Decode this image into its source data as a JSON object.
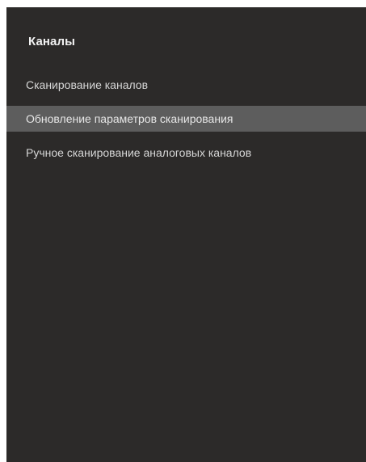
{
  "panel": {
    "title": "Каналы"
  },
  "menu": {
    "items": [
      {
        "label": "Сканирование каналов",
        "selected": false
      },
      {
        "label": "Обновление параметров сканирования",
        "selected": true
      },
      {
        "label": "Ручное сканирование аналоговых каналов",
        "selected": false
      }
    ]
  },
  "colors": {
    "panel_background": "#2c2a29",
    "selected_background": "#5d5d5d",
    "text": "#d6d6d6"
  }
}
